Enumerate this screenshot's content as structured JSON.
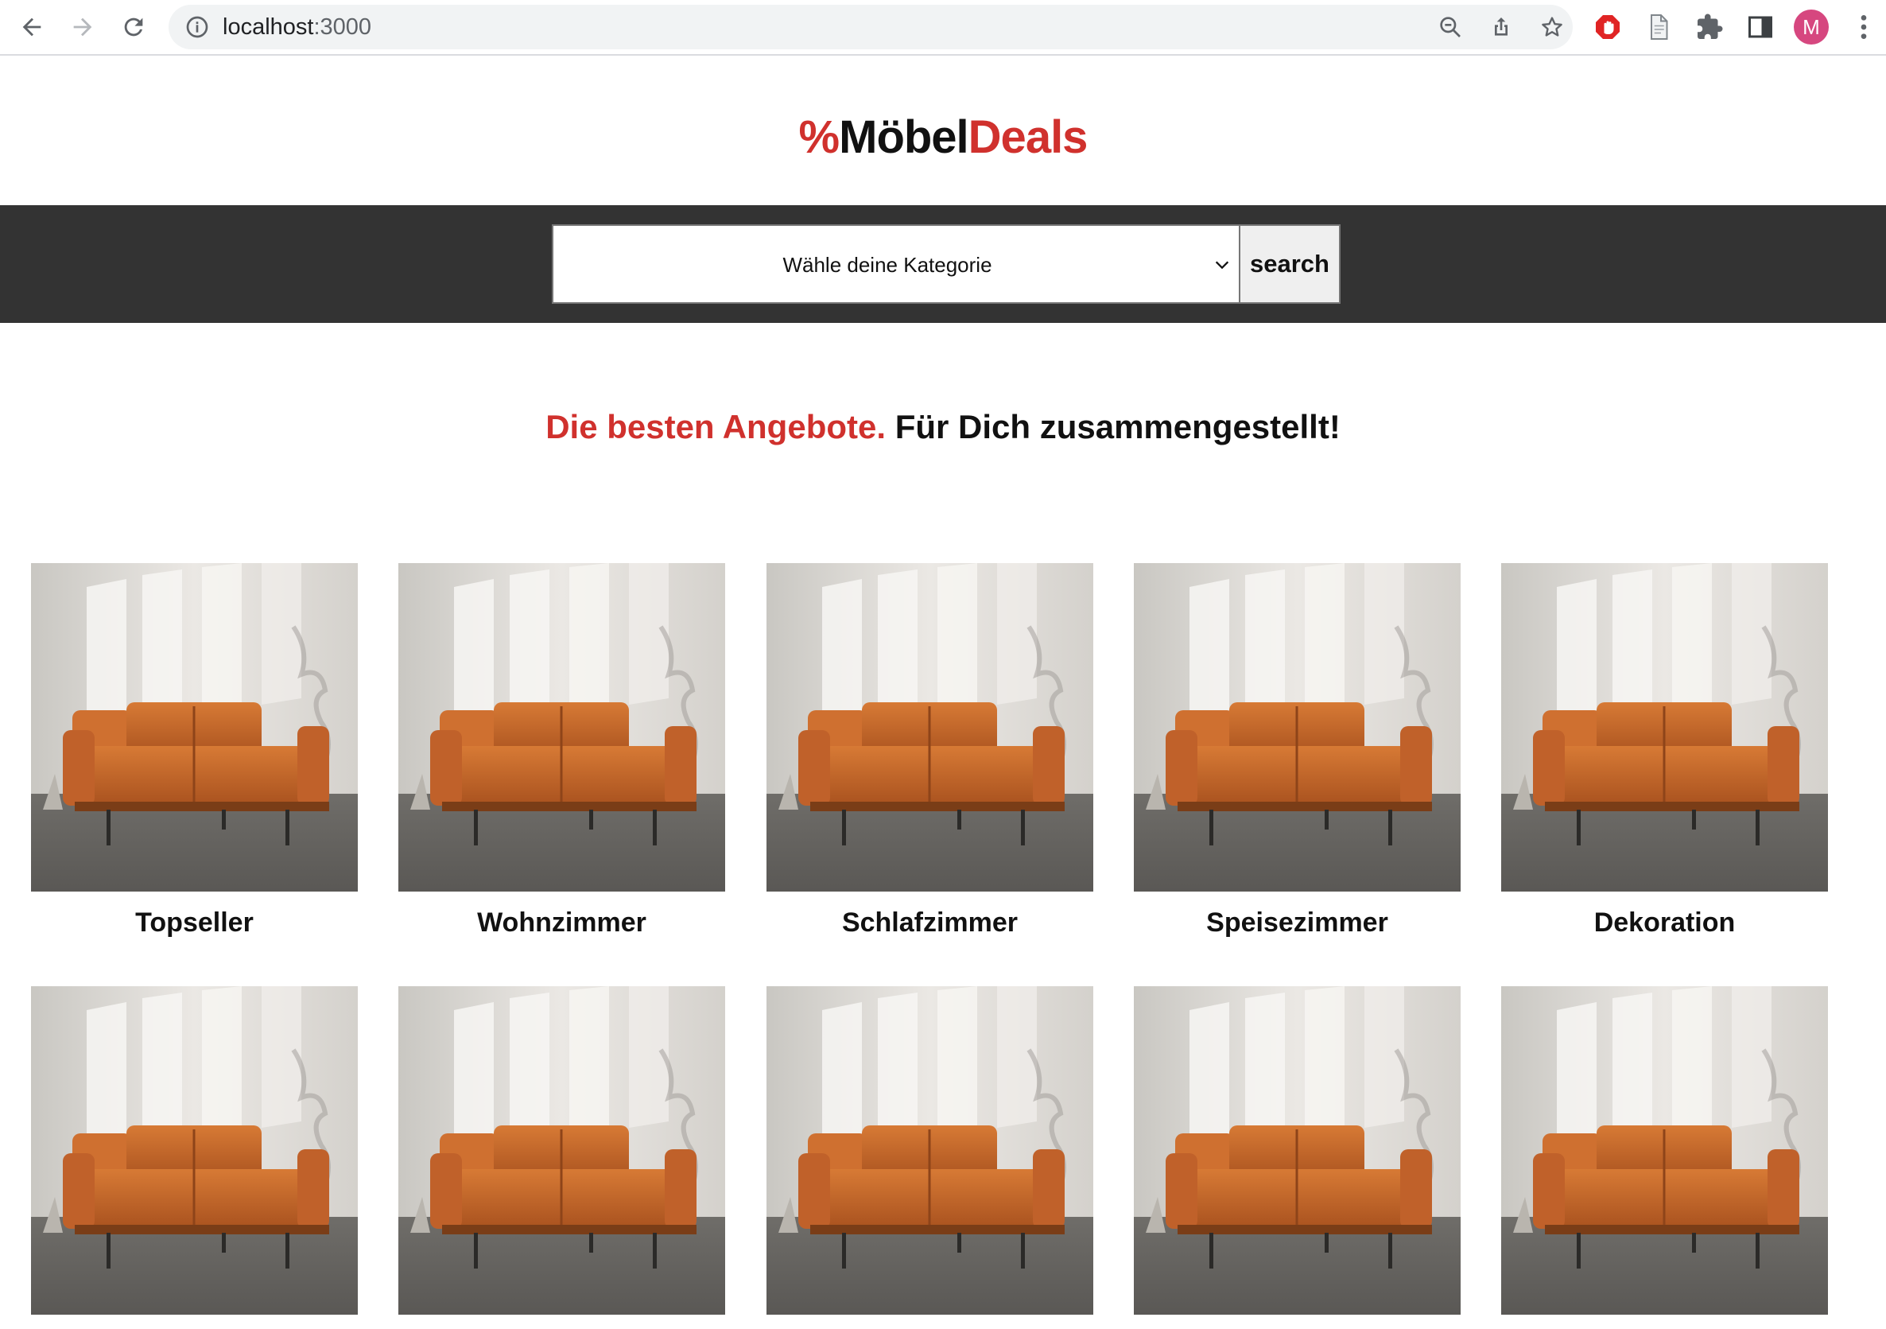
{
  "browser": {
    "url_host": "localhost",
    "url_port": ":3000",
    "profile_initial": "M",
    "icons": {
      "back": "back-arrow-icon",
      "forward": "forward-arrow-icon",
      "reload": "reload-icon",
      "site_info": "info-icon",
      "zoom": "zoom-out-icon",
      "share": "share-icon",
      "bookmark": "star-icon",
      "adblock": "stop-hand-icon",
      "page": "document-icon",
      "extensions": "puzzle-icon",
      "sidepanel": "side-panel-icon",
      "menu": "kebab-menu-icon"
    }
  },
  "logo": {
    "percent": "%",
    "brand_black": "Möbel",
    "brand_red": "Deals"
  },
  "search": {
    "select_value": "Wähle deine Kategorie",
    "button_label": "search"
  },
  "headline": {
    "red_part": "Die besten Angebote.",
    "black_part": " Für Dich zusammengestellt!"
  },
  "categories": [
    {
      "label": "Topseller"
    },
    {
      "label": "Wohnzimmer"
    },
    {
      "label": "Schlafzimmer"
    },
    {
      "label": "Speisezimmer"
    },
    {
      "label": "Dekoration"
    },
    {
      "label": ""
    },
    {
      "label": ""
    },
    {
      "label": ""
    },
    {
      "label": ""
    },
    {
      "label": ""
    }
  ],
  "colors": {
    "accent_red": "#d0312d",
    "searchbar_bg": "#333333",
    "sofa": "#c8662a"
  }
}
